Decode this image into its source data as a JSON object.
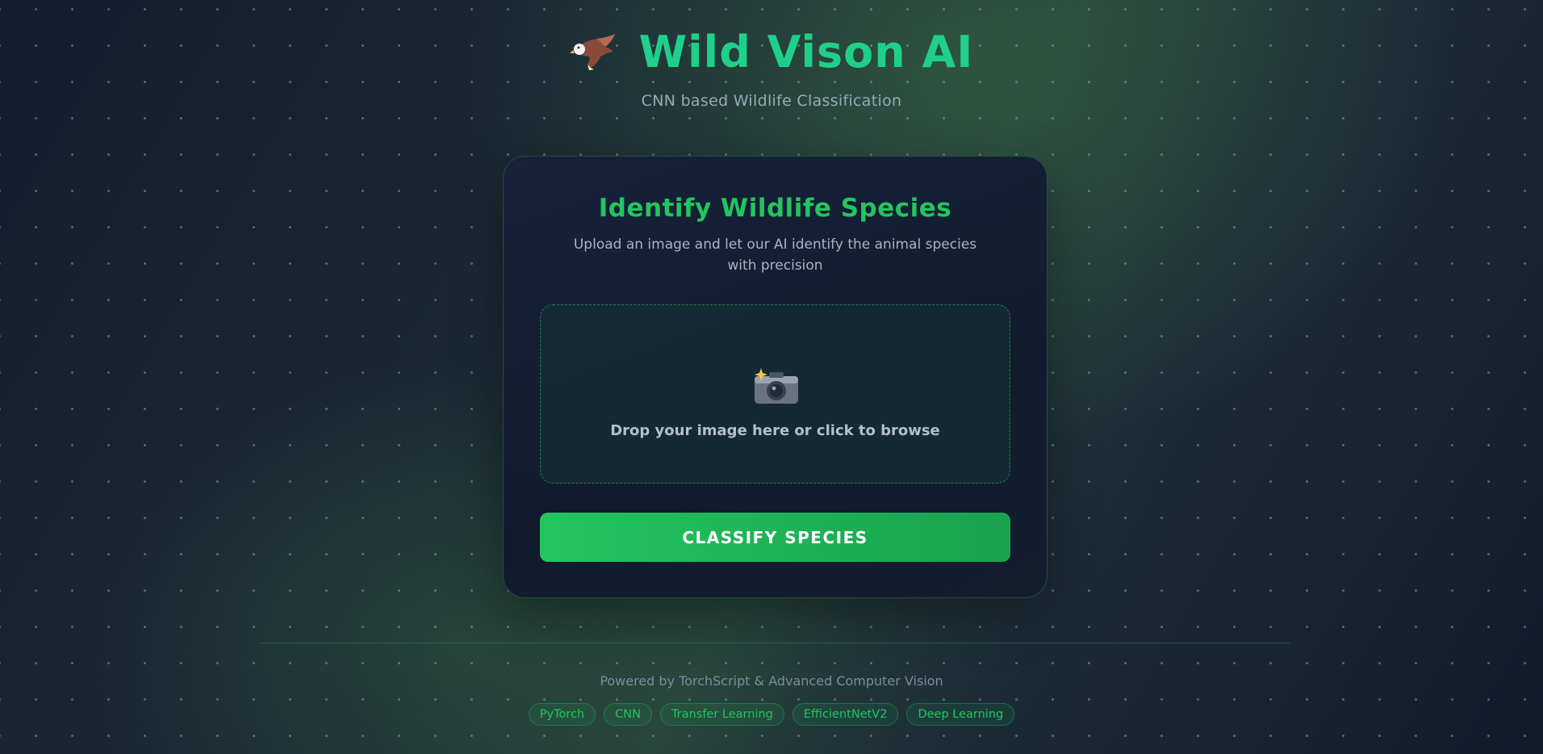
{
  "header": {
    "logo_icon": "eagle-icon",
    "title": "Wild Vison AI",
    "subtitle": "CNN based Wildlife Classification"
  },
  "card": {
    "title": "Identify Wildlife Species",
    "description": "Upload an image and let our AI identify the animal species with precision",
    "dropzone": {
      "icon": "camera-icon",
      "text": "Drop your image here or click to browse"
    },
    "classify_button": "CLASSIFY SPECIES"
  },
  "footer": {
    "powered_by": "Powered by TorchScript & Advanced Computer Vision",
    "tags": [
      "PyTorch",
      "CNN",
      "Transfer Learning",
      "EfficientNetV2",
      "Deep Learning"
    ]
  },
  "colors": {
    "accent": "#22c55e",
    "title": "#1fd08a",
    "background": "#111a2c",
    "card": "#16213a"
  }
}
